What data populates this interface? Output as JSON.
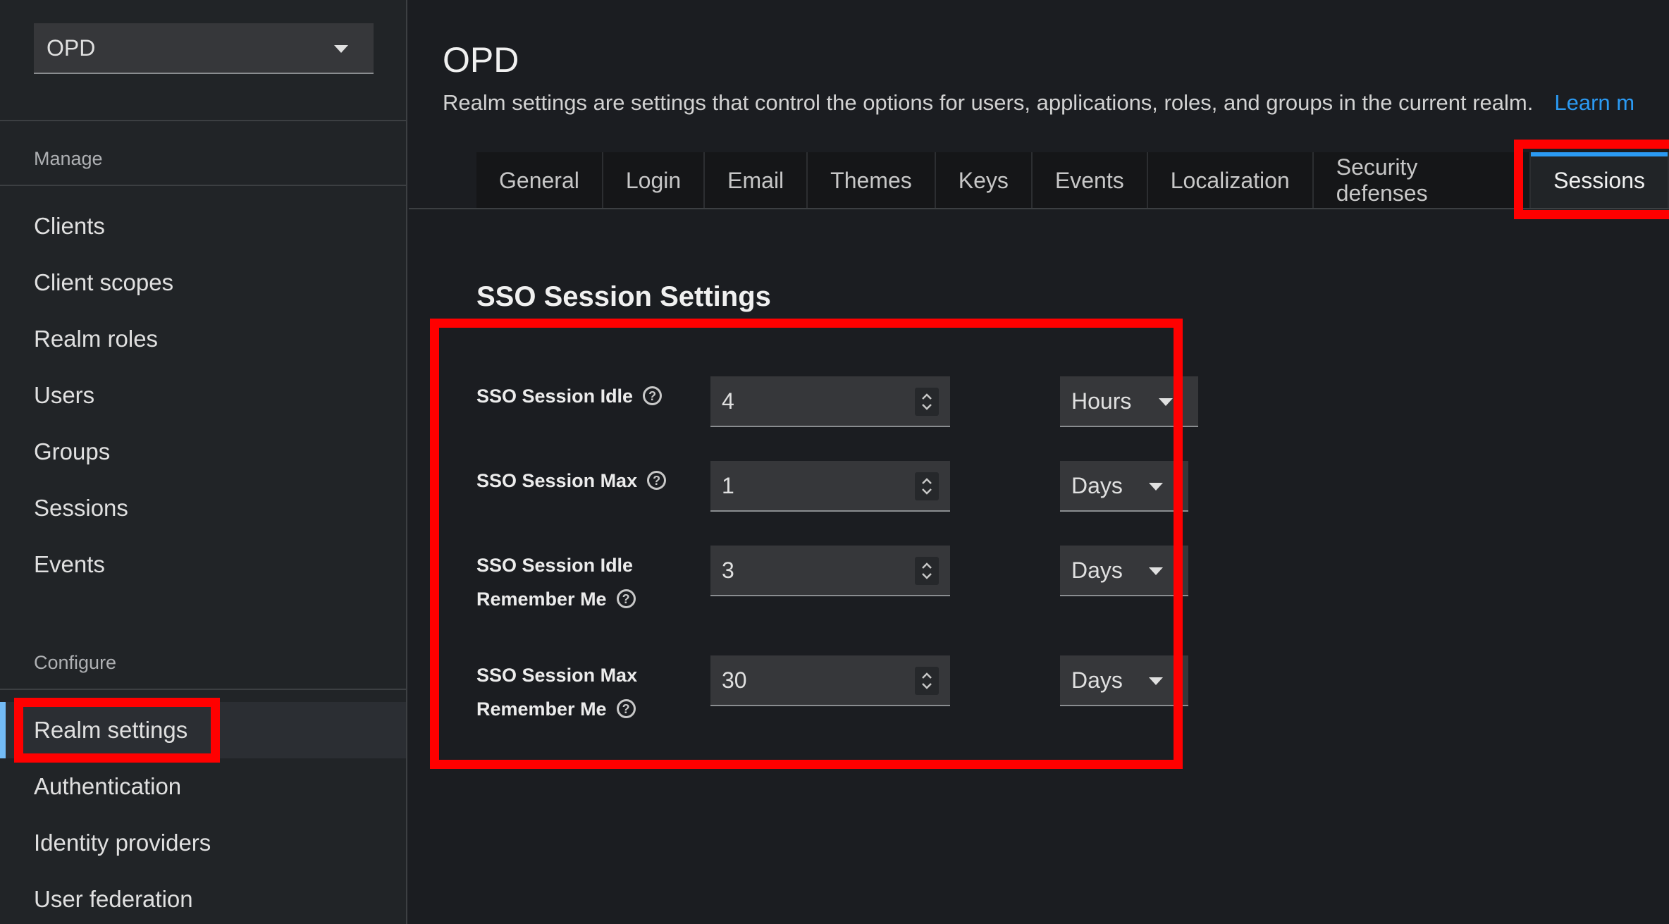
{
  "sidebar": {
    "realm_selector": {
      "value": "OPD"
    },
    "sections": {
      "manage": "Manage",
      "configure": "Configure"
    },
    "manage_items": [
      {
        "label": "Clients"
      },
      {
        "label": "Client scopes"
      },
      {
        "label": "Realm roles"
      },
      {
        "label": "Users"
      },
      {
        "label": "Groups"
      },
      {
        "label": "Sessions"
      },
      {
        "label": "Events"
      }
    ],
    "configure_items": [
      {
        "label": "Realm settings",
        "active": true
      },
      {
        "label": "Authentication"
      },
      {
        "label": "Identity providers"
      },
      {
        "label": "User federation"
      }
    ]
  },
  "header": {
    "title": "OPD",
    "description": "Realm settings are settings that control the options for users, applications, roles, and groups in the current realm.",
    "learn_more": "Learn m"
  },
  "tabs": [
    {
      "label": "General"
    },
    {
      "label": "Login"
    },
    {
      "label": "Email"
    },
    {
      "label": "Themes"
    },
    {
      "label": "Keys"
    },
    {
      "label": "Events"
    },
    {
      "label": "Localization"
    },
    {
      "label": "Security defenses"
    },
    {
      "label": "Sessions",
      "active": true
    }
  ],
  "sso_section": {
    "title": "SSO Session Settings",
    "fields": [
      {
        "label": "SSO Session Idle",
        "value": "4",
        "unit": "Hours"
      },
      {
        "label": "SSO Session Max",
        "value": "1",
        "unit": "Days"
      },
      {
        "label_line1": "SSO Session Idle",
        "label_line2": "Remember Me",
        "value": "3",
        "unit": "Days"
      },
      {
        "label_line1": "SSO Session Max",
        "label_line2": "Remember Me",
        "value": "30",
        "unit": "Days"
      }
    ]
  },
  "colors": {
    "accent": "#2b9af3",
    "highlight": "#ff0000",
    "active_nav_bar": "#73bcf7"
  }
}
